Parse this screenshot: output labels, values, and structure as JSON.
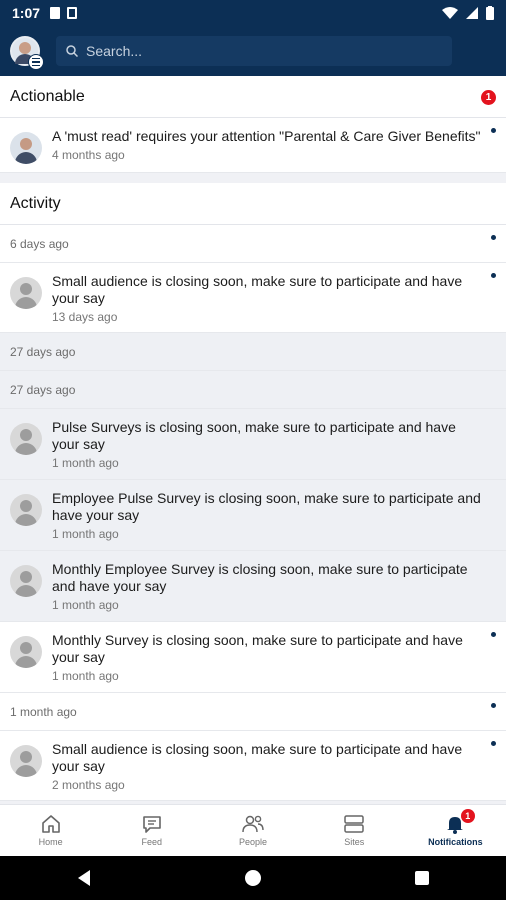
{
  "status_bar": {
    "time": "1:07"
  },
  "header": {
    "search_placeholder": "Search..."
  },
  "actionable": {
    "title": "Actionable",
    "count": "1",
    "items": [
      {
        "text": "A 'must read' requires your attention \"Parental & Care Giver Benefits\"",
        "time": "4 months ago"
      }
    ]
  },
  "activity": {
    "title": "Activity",
    "groups": [
      {
        "date": "6 days ago",
        "items": [
          {
            "text": "Small audience is closing soon, make sure to participate and have your say",
            "time": "13 days ago"
          }
        ]
      },
      {
        "date": "27 days ago",
        "items": []
      },
      {
        "date": "27 days ago",
        "items": [
          {
            "text": "Pulse Surveys is closing soon, make sure to participate and have your say",
            "time": "1 month ago"
          },
          {
            "text": "Employee Pulse Survey is closing soon, make sure to participate and have your say",
            "time": "1 month ago"
          },
          {
            "text": "Monthly Employee Survey is closing soon, make sure to participate and have your say",
            "time": "1 month ago"
          },
          {
            "text": "Monthly Survey is closing soon, make sure to participate and have your say",
            "time": "1 month ago"
          }
        ]
      },
      {
        "date": "1 month ago",
        "items": [
          {
            "text": "Small audience is closing soon, make sure to participate and have your say",
            "time": "2 months ago"
          }
        ]
      }
    ]
  },
  "bottom_nav": {
    "home": "Home",
    "feed": "Feed",
    "people": "People",
    "sites": "Sites",
    "notifications": "Notifications",
    "notifications_badge": "1"
  },
  "colors": {
    "brand": "#0c2f55",
    "badge": "#e3131e"
  }
}
